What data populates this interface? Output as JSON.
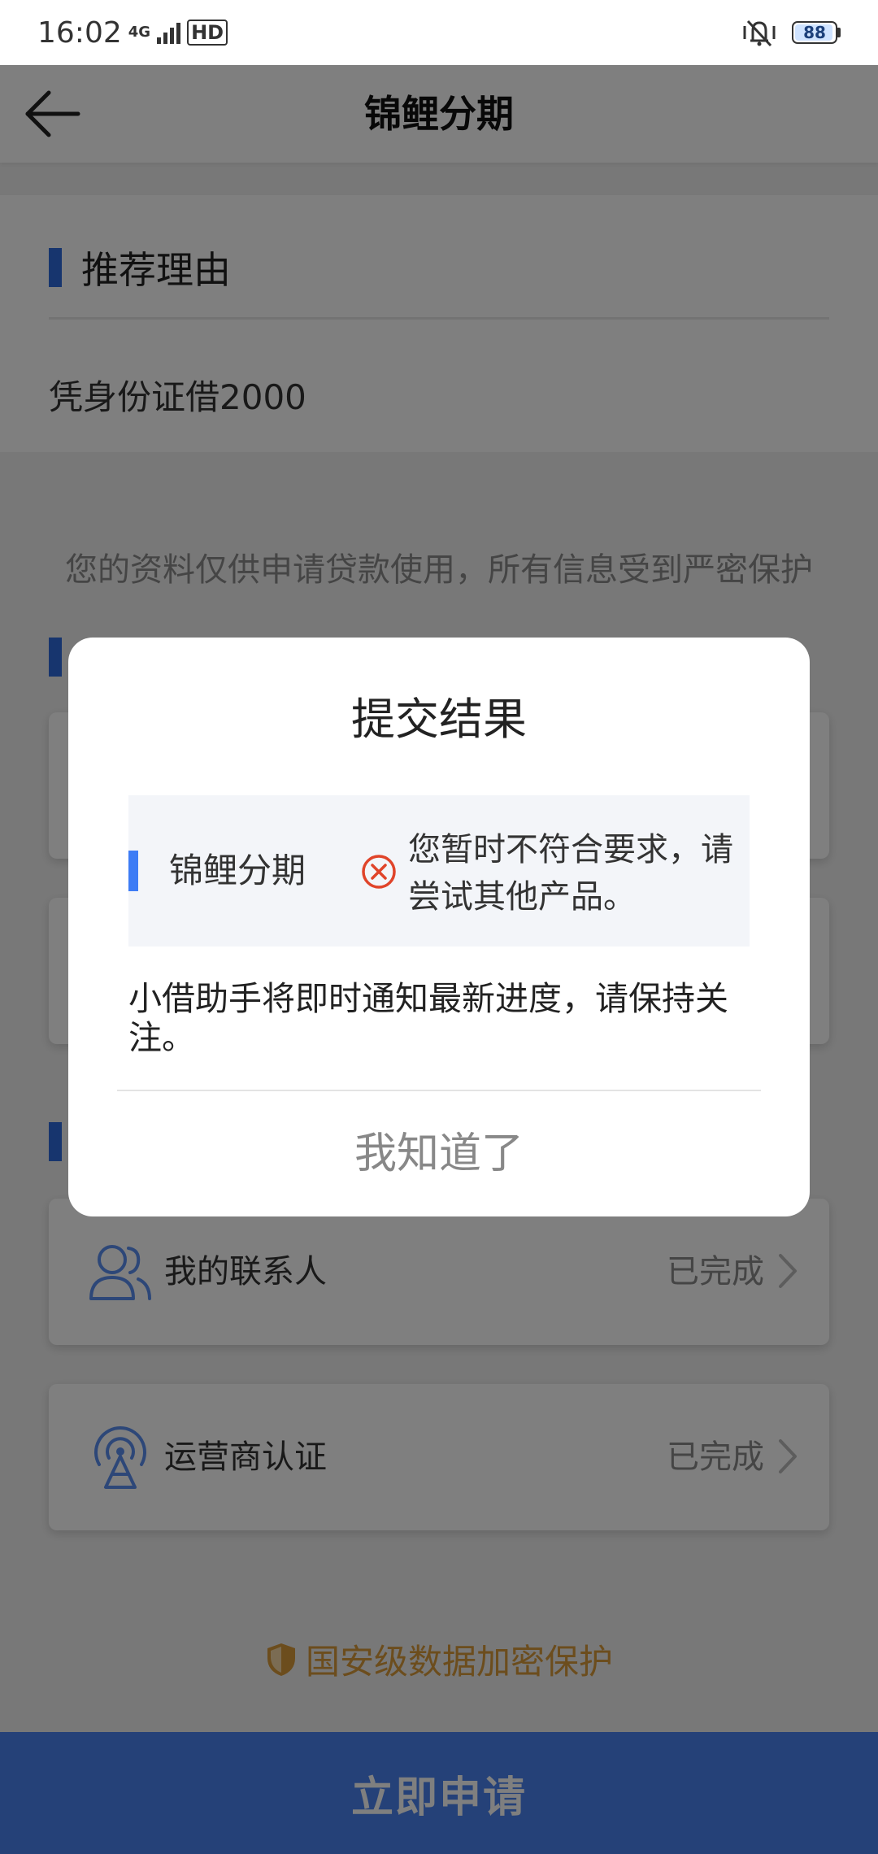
{
  "status_bar": {
    "time": "16:02",
    "network": "4G",
    "hd": "HD",
    "battery": "88"
  },
  "header": {
    "title": "锦鲤分期"
  },
  "recommend": {
    "title": "推荐理由",
    "text": "凭身份证借2000"
  },
  "privacy_note": "您的资料仅供申请贷款使用，所有信息受到严密保护",
  "cards": [
    {
      "label": "我的联系人",
      "status": "已完成",
      "icon": "contacts-icon"
    },
    {
      "label": "运营商认证",
      "status": "已完成",
      "icon": "signal-tower-icon"
    }
  ],
  "security_label": "国安级数据加密保护",
  "apply_button": "立即申请",
  "dialog": {
    "title": "提交结果",
    "product": "锦鲤分期",
    "message": "您暂时不符合要求，请尝试其他产品。",
    "note": "小借助手将即时通知最新进度，请保持关注。",
    "confirm": "我知道了"
  },
  "colors": {
    "accent": "#2f6bdd",
    "apply_bar": "#4a82f0",
    "error": "#e0442a",
    "security": "#d99a3a"
  }
}
